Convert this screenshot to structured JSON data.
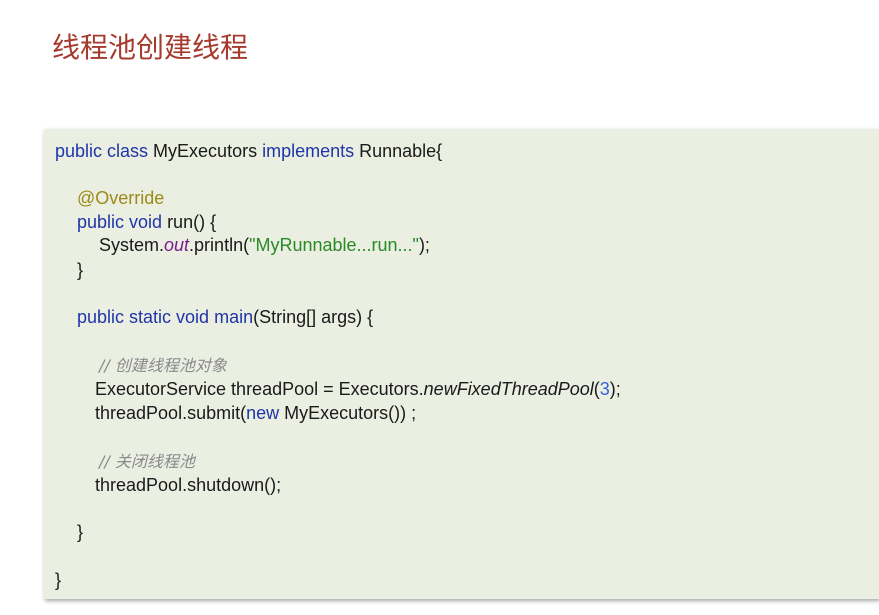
{
  "slide": {
    "title": "线程池创建线程"
  },
  "code": {
    "l1": {
      "kw1": "public class",
      "name": " MyExecutors ",
      "kw2": "implements",
      "rest": " Runnable{"
    },
    "l2": {
      "annotation": "@Override"
    },
    "l3": {
      "kw": "public void",
      "rest": " run() {"
    },
    "l4": {
      "pre": "System.",
      "field": "out",
      "mid": ".println(",
      "str": "\"MyRunnable...run...\"",
      "end": ");"
    },
    "l5": {
      "text": "}"
    },
    "l6": {
      "kw": "public static void",
      "method": " main",
      "rest": "(String[] args) {"
    },
    "l7": {
      "comment": "// 创建线程池对象"
    },
    "l8": {
      "pre": "ExecutorService threadPool = Executors.",
      "method": "newFixedThreadPool",
      "open": "(",
      "num": "3",
      "end": ");"
    },
    "l9": {
      "pre": "threadPool.submit(",
      "kw": "new",
      "rest": " MyExecutors()) ;"
    },
    "l10": {
      "comment": "// 关闭线程池"
    },
    "l11": {
      "text": "threadPool.shutdown();"
    },
    "l12": {
      "text": "}"
    },
    "l13": {
      "text": "}"
    }
  },
  "colors": {
    "title": "#a63a2c",
    "panel_bg": "#eaefe2",
    "keyword": "#1f35a8",
    "annotation": "#9c8a18",
    "string": "#2a8a25",
    "number": "#3560d8",
    "static_field": "#7a1e8a",
    "comment": "#8a8a8a"
  }
}
